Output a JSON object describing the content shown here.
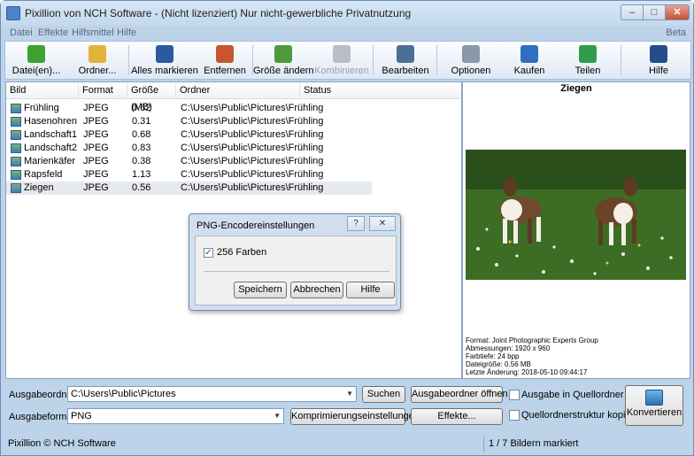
{
  "window": {
    "title": "Pixillion von NCH Software - (Nicht lizenziert) Nur nicht-gewerbliche Privatnutzung"
  },
  "window_controls": {
    "minimize": "–",
    "maximize": "□",
    "close": "✕"
  },
  "menu": {
    "items": [
      "Datei",
      "Effekte",
      "Hilfsmittel",
      "Hilfe"
    ],
    "beta": "Beta"
  },
  "toolbar": {
    "buttons": [
      {
        "label": "Datei(en)...",
        "icon": "add-file-icon",
        "color": "#3ca32e"
      },
      {
        "label": "Ordner...",
        "icon": "add-folder-icon",
        "color": "#e2b33b"
      },
      {
        "label": "Alles markieren",
        "icon": "select-all-icon",
        "color": "#2d5a9e"
      },
      {
        "label": "Entfernen",
        "icon": "remove-icon",
        "color": "#c9552f"
      },
      {
        "label": "Größe ändern",
        "icon": "resize-icon",
        "color": "#4d9a3a"
      },
      {
        "label": "Kombinieren",
        "icon": "combine-icon",
        "color": "#b7bec8",
        "disabled": true
      },
      {
        "label": "Bearbeiten",
        "icon": "edit-icon",
        "color": "#4e6f95"
      },
      {
        "label": "Optionen",
        "icon": "options-icon",
        "color": "#8a98a8"
      },
      {
        "label": "Kaufen",
        "icon": "buy-icon",
        "color": "#2f6fbf"
      },
      {
        "label": "Teilen",
        "icon": "share-icon",
        "color": "#2e9c48"
      },
      {
        "label": "Hilfe",
        "icon": "help-icon",
        "color": "#244d8a"
      }
    ]
  },
  "file_list": {
    "columns": [
      "Bild",
      "Format",
      "Größe (MB)",
      "Ordner",
      "Status"
    ],
    "rows": [
      {
        "name": "Frühling",
        "format": "JPEG",
        "size": "0.62",
        "folder": "C:\\Users\\Public\\Pictures\\Frühling",
        "status": ""
      },
      {
        "name": "Hasenohren",
        "format": "JPEG",
        "size": "0.31",
        "folder": "C:\\Users\\Public\\Pictures\\Frühling",
        "status": ""
      },
      {
        "name": "Landschaft1",
        "format": "JPEG",
        "size": "0.68",
        "folder": "C:\\Users\\Public\\Pictures\\Frühling",
        "status": ""
      },
      {
        "name": "Landschaft2",
        "format": "JPEG",
        "size": "0.83",
        "folder": "C:\\Users\\Public\\Pictures\\Frühling",
        "status": ""
      },
      {
        "name": "Marienkäfer",
        "format": "JPEG",
        "size": "0.38",
        "folder": "C:\\Users\\Public\\Pictures\\Frühling",
        "status": ""
      },
      {
        "name": "Rapsfeld",
        "format": "JPEG",
        "size": "1.13",
        "folder": "C:\\Users\\Public\\Pictures\\Frühling",
        "status": ""
      },
      {
        "name": "Ziegen",
        "format": "JPEG",
        "size": "0.56",
        "folder": "C:\\Users\\Public\\Pictures\\Frühling",
        "status": "",
        "selected": true
      }
    ]
  },
  "preview": {
    "title": "Ziegen",
    "info": [
      "Format: Joint Photographic Experts Group",
      "Abmessungen: 1920 x 960",
      "Farbtiefe: 24 bpp",
      "Dateigröße: 0.56 MB",
      "Letzte Änderung: 2018-05-10 09:44:17"
    ]
  },
  "dialog": {
    "title": "PNG-Encodereinstellungen",
    "help_btn": "?",
    "close_btn": "✕",
    "checkbox_label": "256 Farben",
    "checkbox_checked": true,
    "check_mark": "✓",
    "buttons": {
      "save": "Speichern",
      "cancel": "Abbrechen",
      "help": "Hilfe"
    }
  },
  "output": {
    "folder_label": "Ausgabeordner:",
    "folder_value": "C:\\Users\\Public\\Pictures",
    "search_btn": "Suchen",
    "open_folder_btn": "Ausgabeordner öffnen",
    "format_label": "Ausgabeformat:",
    "format_value": "PNG",
    "compression_btn": "Komprimierungseinstellungen...",
    "effects_btn": "Effekte...",
    "source_folder_label": "Ausgabe in Quellordner",
    "copy_structure_label": "Quellordnerstruktur kopieren",
    "convert_btn": "Konvertieren",
    "dropdown_arrow": "▼"
  },
  "status": {
    "left": "Pixillion © NCH Software",
    "right": "1 / 7 Bildern markiert"
  }
}
